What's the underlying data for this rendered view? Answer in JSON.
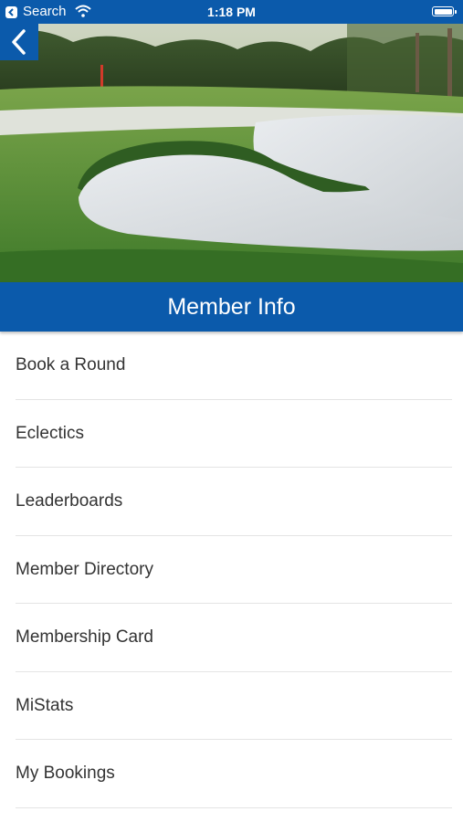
{
  "status_bar": {
    "back_app_label": "Search",
    "time": "1:18 PM"
  },
  "header": {
    "title": "Member Info"
  },
  "menu": {
    "items": [
      {
        "label": "Book a Round"
      },
      {
        "label": "Eclectics"
      },
      {
        "label": "Leaderboards"
      },
      {
        "label": "Member Directory"
      },
      {
        "label": "Membership Card"
      },
      {
        "label": "MiStats"
      },
      {
        "label": "My Bookings"
      }
    ]
  },
  "theme": {
    "brand_blue": "#0b5aab",
    "text": "#333333",
    "divider": "#e4e4e4"
  },
  "icons": [
    "back-small-icon",
    "wifi-icon",
    "battery-icon",
    "back-chevron-icon"
  ]
}
